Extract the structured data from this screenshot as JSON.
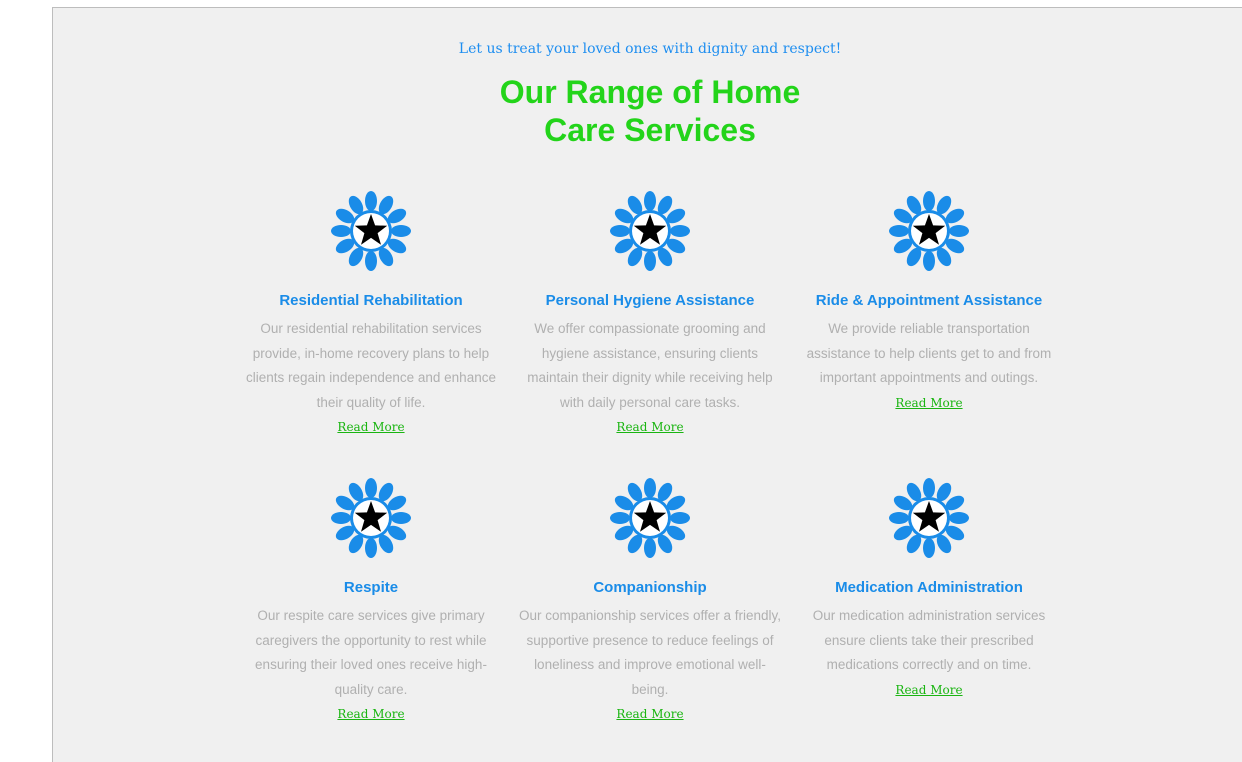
{
  "section": {
    "tagline": "Let us treat your loved ones with dignity and respect!",
    "heading_line1": "Our Range of Home",
    "heading_line2": "Care Services"
  },
  "colors": {
    "accent_blue": "#1a8ce8",
    "accent_green": "#23d41a",
    "text_gray": "#b0b0b0",
    "background": "#f0f0f0"
  },
  "services": [
    {
      "icon": "star-badge-icon",
      "title": "Residential Rehabilitation",
      "description": "Our residential rehabilitation services provide, in-home recovery plans to help clients regain independence and enhance their quality of life.",
      "link": "Read More"
    },
    {
      "icon": "star-badge-icon",
      "title": "Personal Hygiene Assistance",
      "description": "We offer compassionate grooming and hygiene assistance, ensuring clients maintain their dignity while receiving help with daily personal care tasks.",
      "link": "Read More"
    },
    {
      "icon": "star-badge-icon",
      "title": "Ride & Appointment Assistance",
      "description": "We provide reliable transportation assistance to help clients get to and from important appointments and outings.",
      "link": "Read More"
    },
    {
      "icon": "star-badge-icon",
      "title": "Respite",
      "description": "Our respite care services give primary caregivers the opportunity to rest while ensuring their loved ones receive high-quality care.",
      "link": "Read More"
    },
    {
      "icon": "star-badge-icon",
      "title": "Companionship",
      "description": "Our companionship services offer a friendly, supportive presence to reduce feelings of loneliness and improve emotional well-being.",
      "link": "Read More"
    },
    {
      "icon": "star-badge-icon",
      "title": "Medication Administration",
      "description": "Our medication administration services ensure clients take their prescribed medications correctly and on time.",
      "link": "Read More"
    }
  ]
}
